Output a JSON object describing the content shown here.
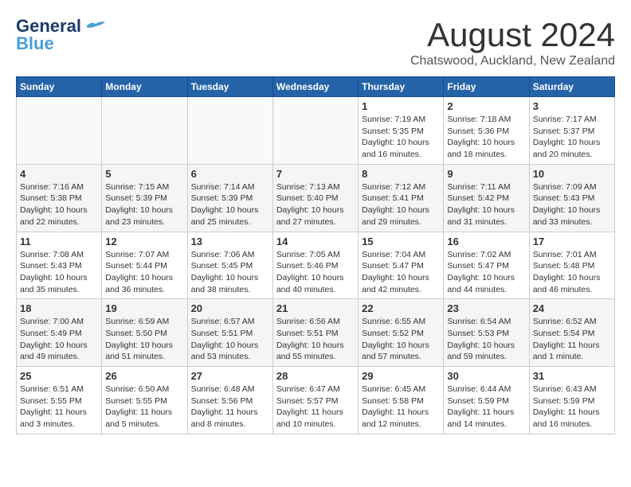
{
  "header": {
    "logo_line1": "General",
    "logo_line2": "Blue",
    "month": "August 2024",
    "location": "Chatswood, Auckland, New Zealand"
  },
  "weekdays": [
    "Sunday",
    "Monday",
    "Tuesday",
    "Wednesday",
    "Thursday",
    "Friday",
    "Saturday"
  ],
  "weeks": [
    [
      {
        "day": "",
        "info": ""
      },
      {
        "day": "",
        "info": ""
      },
      {
        "day": "",
        "info": ""
      },
      {
        "day": "",
        "info": ""
      },
      {
        "day": "1",
        "info": "Sunrise: 7:19 AM\nSunset: 5:35 PM\nDaylight: 10 hours\nand 16 minutes."
      },
      {
        "day": "2",
        "info": "Sunrise: 7:18 AM\nSunset: 5:36 PM\nDaylight: 10 hours\nand 18 minutes."
      },
      {
        "day": "3",
        "info": "Sunrise: 7:17 AM\nSunset: 5:37 PM\nDaylight: 10 hours\nand 20 minutes."
      }
    ],
    [
      {
        "day": "4",
        "info": "Sunrise: 7:16 AM\nSunset: 5:38 PM\nDaylight: 10 hours\nand 22 minutes."
      },
      {
        "day": "5",
        "info": "Sunrise: 7:15 AM\nSunset: 5:39 PM\nDaylight: 10 hours\nand 23 minutes."
      },
      {
        "day": "6",
        "info": "Sunrise: 7:14 AM\nSunset: 5:39 PM\nDaylight: 10 hours\nand 25 minutes."
      },
      {
        "day": "7",
        "info": "Sunrise: 7:13 AM\nSunset: 5:40 PM\nDaylight: 10 hours\nand 27 minutes."
      },
      {
        "day": "8",
        "info": "Sunrise: 7:12 AM\nSunset: 5:41 PM\nDaylight: 10 hours\nand 29 minutes."
      },
      {
        "day": "9",
        "info": "Sunrise: 7:11 AM\nSunset: 5:42 PM\nDaylight: 10 hours\nand 31 minutes."
      },
      {
        "day": "10",
        "info": "Sunrise: 7:09 AM\nSunset: 5:43 PM\nDaylight: 10 hours\nand 33 minutes."
      }
    ],
    [
      {
        "day": "11",
        "info": "Sunrise: 7:08 AM\nSunset: 5:43 PM\nDaylight: 10 hours\nand 35 minutes."
      },
      {
        "day": "12",
        "info": "Sunrise: 7:07 AM\nSunset: 5:44 PM\nDaylight: 10 hours\nand 36 minutes."
      },
      {
        "day": "13",
        "info": "Sunrise: 7:06 AM\nSunset: 5:45 PM\nDaylight: 10 hours\nand 38 minutes."
      },
      {
        "day": "14",
        "info": "Sunrise: 7:05 AM\nSunset: 5:46 PM\nDaylight: 10 hours\nand 40 minutes."
      },
      {
        "day": "15",
        "info": "Sunrise: 7:04 AM\nSunset: 5:47 PM\nDaylight: 10 hours\nand 42 minutes."
      },
      {
        "day": "16",
        "info": "Sunrise: 7:02 AM\nSunset: 5:47 PM\nDaylight: 10 hours\nand 44 minutes."
      },
      {
        "day": "17",
        "info": "Sunrise: 7:01 AM\nSunset: 5:48 PM\nDaylight: 10 hours\nand 46 minutes."
      }
    ],
    [
      {
        "day": "18",
        "info": "Sunrise: 7:00 AM\nSunset: 5:49 PM\nDaylight: 10 hours\nand 49 minutes."
      },
      {
        "day": "19",
        "info": "Sunrise: 6:59 AM\nSunset: 5:50 PM\nDaylight: 10 hours\nand 51 minutes."
      },
      {
        "day": "20",
        "info": "Sunrise: 6:57 AM\nSunset: 5:51 PM\nDaylight: 10 hours\nand 53 minutes."
      },
      {
        "day": "21",
        "info": "Sunrise: 6:56 AM\nSunset: 5:51 PM\nDaylight: 10 hours\nand 55 minutes."
      },
      {
        "day": "22",
        "info": "Sunrise: 6:55 AM\nSunset: 5:52 PM\nDaylight: 10 hours\nand 57 minutes."
      },
      {
        "day": "23",
        "info": "Sunrise: 6:54 AM\nSunset: 5:53 PM\nDaylight: 10 hours\nand 59 minutes."
      },
      {
        "day": "24",
        "info": "Sunrise: 6:52 AM\nSunset: 5:54 PM\nDaylight: 11 hours\nand 1 minute."
      }
    ],
    [
      {
        "day": "25",
        "info": "Sunrise: 6:51 AM\nSunset: 5:55 PM\nDaylight: 11 hours\nand 3 minutes."
      },
      {
        "day": "26",
        "info": "Sunrise: 6:50 AM\nSunset: 5:55 PM\nDaylight: 11 hours\nand 5 minutes."
      },
      {
        "day": "27",
        "info": "Sunrise: 6:48 AM\nSunset: 5:56 PM\nDaylight: 11 hours\nand 8 minutes."
      },
      {
        "day": "28",
        "info": "Sunrise: 6:47 AM\nSunset: 5:57 PM\nDaylight: 11 hours\nand 10 minutes."
      },
      {
        "day": "29",
        "info": "Sunrise: 6:45 AM\nSunset: 5:58 PM\nDaylight: 11 hours\nand 12 minutes."
      },
      {
        "day": "30",
        "info": "Sunrise: 6:44 AM\nSunset: 5:59 PM\nDaylight: 11 hours\nand 14 minutes."
      },
      {
        "day": "31",
        "info": "Sunrise: 6:43 AM\nSunset: 5:59 PM\nDaylight: 11 hours\nand 16 minutes."
      }
    ]
  ]
}
